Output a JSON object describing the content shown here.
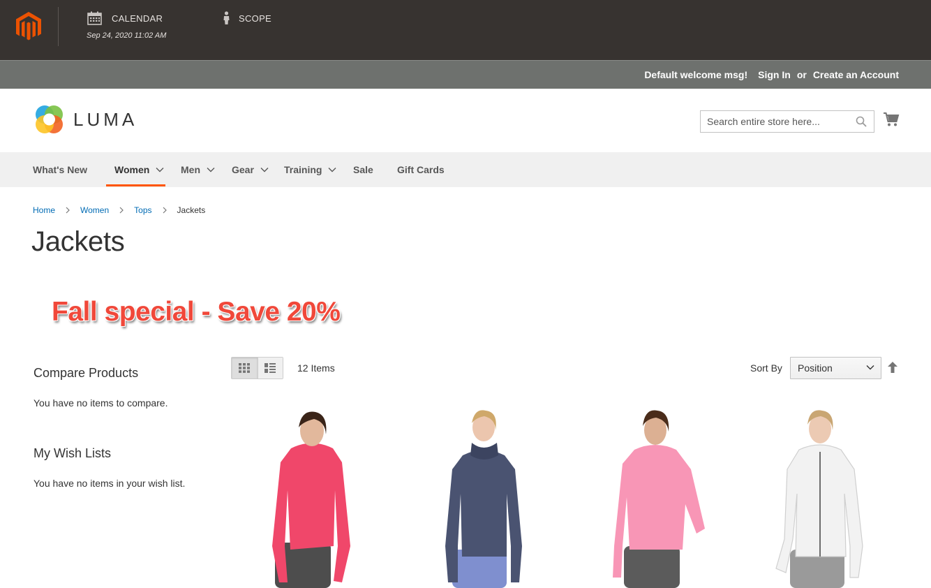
{
  "admin_bar": {
    "calendar_label": "CALENDAR",
    "calendar_date": "Sep 24, 2020 11:02 AM",
    "scope_label": "SCOPE",
    "logo_icon": "magento-logo-icon",
    "brand_color": "#eb5202"
  },
  "panel": {
    "welcome": "Default welcome msg!",
    "sign_in": "Sign In",
    "or": "or",
    "create_account": "Create an Account"
  },
  "header": {
    "logo_text": "LUMA",
    "search_placeholder": "Search entire store here...",
    "search_icon": "search-icon",
    "cart_icon": "cart-icon"
  },
  "nav": {
    "items": [
      {
        "label": "What's New",
        "has_dropdown": false
      },
      {
        "label": "Women",
        "has_dropdown": true,
        "active": true
      },
      {
        "label": "Men",
        "has_dropdown": true
      },
      {
        "label": "Gear",
        "has_dropdown": true
      },
      {
        "label": "Training",
        "has_dropdown": true
      },
      {
        "label": "Sale",
        "has_dropdown": false
      },
      {
        "label": "Gift Cards",
        "has_dropdown": false
      }
    ],
    "active_color": "#ff5501"
  },
  "breadcrumb": {
    "items": [
      "Home",
      "Women",
      "Tops"
    ],
    "current": "Jackets",
    "link_color": "#006bb4"
  },
  "page": {
    "title": "Jackets",
    "promo": "Fall special - Save 20%",
    "promo_color": "#f0483a"
  },
  "sidebar": {
    "compare_title": "Compare Products",
    "compare_text": "You have no items to compare.",
    "wishlist_title": "My Wish Lists",
    "wishlist_text": "You have no items in your wish list."
  },
  "toolbar": {
    "items_count": "12 Items",
    "sort_label": "Sort By",
    "sort_value": "Position",
    "view_modes": [
      "grid",
      "list"
    ],
    "active_mode": "grid"
  },
  "products": [
    {
      "jacket_color": "#f0476a",
      "pants_color": "#4d4d4d"
    },
    {
      "jacket_color": "#4a5371",
      "pants_color": "#7f8fcf"
    },
    {
      "jacket_color": "#f896b6",
      "pants_color": "#5b5b5b"
    },
    {
      "jacket_color": "#f2f2f2",
      "pants_color": "#9a9a9a"
    }
  ]
}
